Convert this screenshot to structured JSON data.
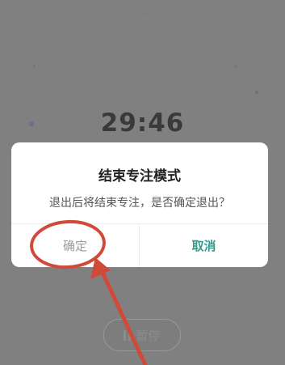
{
  "screen": {
    "timer": "29:46",
    "pause_label": "暂停"
  },
  "dialog": {
    "title": "结束专注模式",
    "message": "退出后将结束专注，是否确定退出？",
    "confirm_label": "确定",
    "cancel_label": "取消"
  },
  "colors": {
    "backdrop": "#808080",
    "accent": "#2f9b8f",
    "annotation": "#d04a3a"
  }
}
